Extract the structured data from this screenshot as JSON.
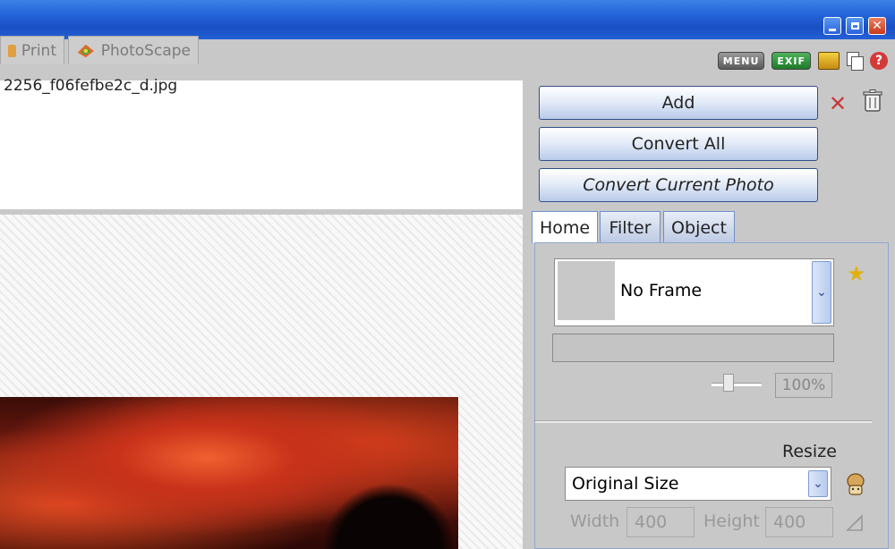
{
  "window": {
    "minimize_icon": "minimize-icon",
    "maximize_icon": "restore-icon",
    "close_icon": "close-icon"
  },
  "tabs": [
    {
      "label": "Print",
      "icon": "printer-icon"
    },
    {
      "label": "PhotoScape",
      "icon": "photoscape-icon"
    }
  ],
  "toolbar": {
    "menu_label": "MENU",
    "exif_label": "EXIF"
  },
  "file": {
    "name": "2256_f06fefbe2c_d.jpg"
  },
  "buttons": {
    "add": "Add",
    "convert_all": "Convert All",
    "convert_current": "Convert Current Photo"
  },
  "panel_tabs": {
    "home": "Home",
    "filter": "Filter",
    "object": "Object"
  },
  "frame": {
    "selected": "No Frame",
    "zoom": "100%"
  },
  "resize": {
    "label": "Resize",
    "selected": "Original Size",
    "width_label": "Width",
    "width_value": "400",
    "height_label": "Height",
    "height_value": "400"
  },
  "colors": {
    "titlebar": "#2362d8",
    "frame_gray": "#c8c8c8",
    "button_border": "#2f4f8a"
  }
}
